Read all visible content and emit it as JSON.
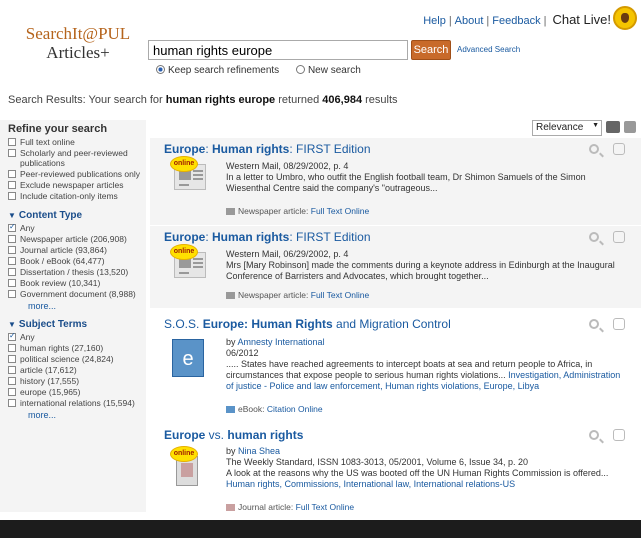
{
  "logo": {
    "line1": "SearchIt@PUL",
    "line2": "Articles+"
  },
  "toplinks": {
    "help": "Help",
    "about": "About",
    "feedback": "Feedback",
    "chat": "Chat Live!"
  },
  "search": {
    "query": "human rights europe",
    "button": "Search",
    "advanced": "Advanced Search",
    "keep": "Keep search refinements",
    "new": "New search"
  },
  "summary": {
    "prefix": "Search Results:",
    "mid": "Your search for",
    "query": "human rights europe",
    "returned": "returned",
    "count": "406,984",
    "suffix": "results"
  },
  "sort": {
    "selected": "Relevance"
  },
  "refine": {
    "title": "Refine your search",
    "options": [
      "Full text online",
      "Scholarly and peer-reviewed publications",
      "Peer-reviewed publications only",
      "Exclude newspaper articles",
      "Include citation-only items"
    ]
  },
  "content_type": {
    "title": "Content Type",
    "items": [
      "Any",
      "Newspaper article (206,908)",
      "Journal article (93,864)",
      "Book / eBook (64,477)",
      "Dissertation / thesis (13,520)",
      "Book review (10,341)",
      "Government document (8,988)"
    ],
    "more": "more..."
  },
  "subject_terms": {
    "title": "Subject Terms",
    "items": [
      "Any",
      "human rights (27,160)",
      "political science (24,824)",
      "article (17,612)",
      "history (17,555)",
      "europe (15,965)",
      "international relations (15,594)"
    ],
    "more": "more..."
  },
  "results": [
    {
      "t1": "Europe",
      "t2": ": ",
      "t3": "Human rights",
      "t4": ": FIRST Edition",
      "source": "Western Mail, 08/29/2002, p. 4",
      "snippet": "In a letter to Umbro, who outfit the English football team, Dr Shimon Samuels of the Simon Wiesenthal Centre said the company's \"outrageous...",
      "type": "Newspaper article:",
      "type_link": "Full Text Online",
      "badge": "online"
    },
    {
      "t1": "Europe",
      "t2": ": ",
      "t3": "Human rights",
      "t4": ": FIRST Edition",
      "source": "Western Mail, 06/29/2002, p. 4",
      "snippet": "Mrs [Mary Robinson] made the comments during a keynote address in Edinburgh at the Inaugural Conference of Barristers and Advocates, which brought together...",
      "type": "Newspaper article:",
      "type_link": "Full Text Online",
      "badge": "online"
    },
    {
      "t1": "S.O.S. ",
      "t2": "Europe",
      "t3": ": Human Rights",
      "t4": " and Migration Control",
      "author_prefix": "by ",
      "author": "Amnesty International",
      "date": "06/2012",
      "snippet": "..... States have reached agreements to intercept boats at sea and return people to Africa, in circumstances that expose people to serious human rights violations...",
      "subjects": "Investigation, Administration of justice - Police and law enforcement, Human rights violations, Europe, Libya",
      "type": "eBook:",
      "type_link": "Citation Online",
      "badge_letter": "e"
    },
    {
      "t1": "Europe",
      "t2": " vs. ",
      "t3": "human rights",
      "t4": "",
      "author_prefix": "by ",
      "author": "Nina Shea",
      "source": "The Weekly Standard, ISSN 1083-3013, 05/2001, Volume 6, Issue 34, p. 20",
      "snippet": "A look at the reasons why the US was booted off the UN Human Rights Commission is offered...",
      "subjects": "Human rights, Commissions, International law, International relations-US",
      "type": "Journal article:",
      "type_link": "Full Text Online",
      "badge": "online"
    }
  ]
}
